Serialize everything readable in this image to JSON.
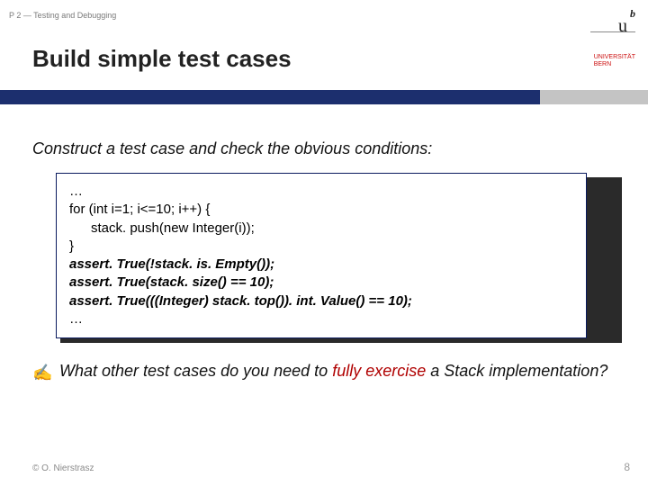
{
  "header": {
    "tag": "P 2 — Testing and Debugging"
  },
  "title": "Build simple test cases",
  "logo": {
    "b": "b",
    "u": "u",
    "line1": "UNIVERSITÄT",
    "line2": "BERN"
  },
  "lead": "Construct a test case and check the obvious conditions:",
  "code": {
    "l1": "…",
    "l2": "for (int i=1; i<=10; i++) {",
    "l3": "stack. push(new Integer(i));",
    "l4": "}",
    "l5": "assert. True(!stack. is. Empty());",
    "l6": "assert. True(stack. size() == 10);",
    "l7": "assert. True(((Integer) stack. top()). int. Value() == 10);",
    "l8": "…"
  },
  "hand_icon": "✍",
  "question": {
    "before": "What other test cases do you need to ",
    "em": "fully exercise",
    "after": " a Stack implementation?"
  },
  "footer": {
    "left": "© O. Nierstrasz",
    "right": "8"
  }
}
